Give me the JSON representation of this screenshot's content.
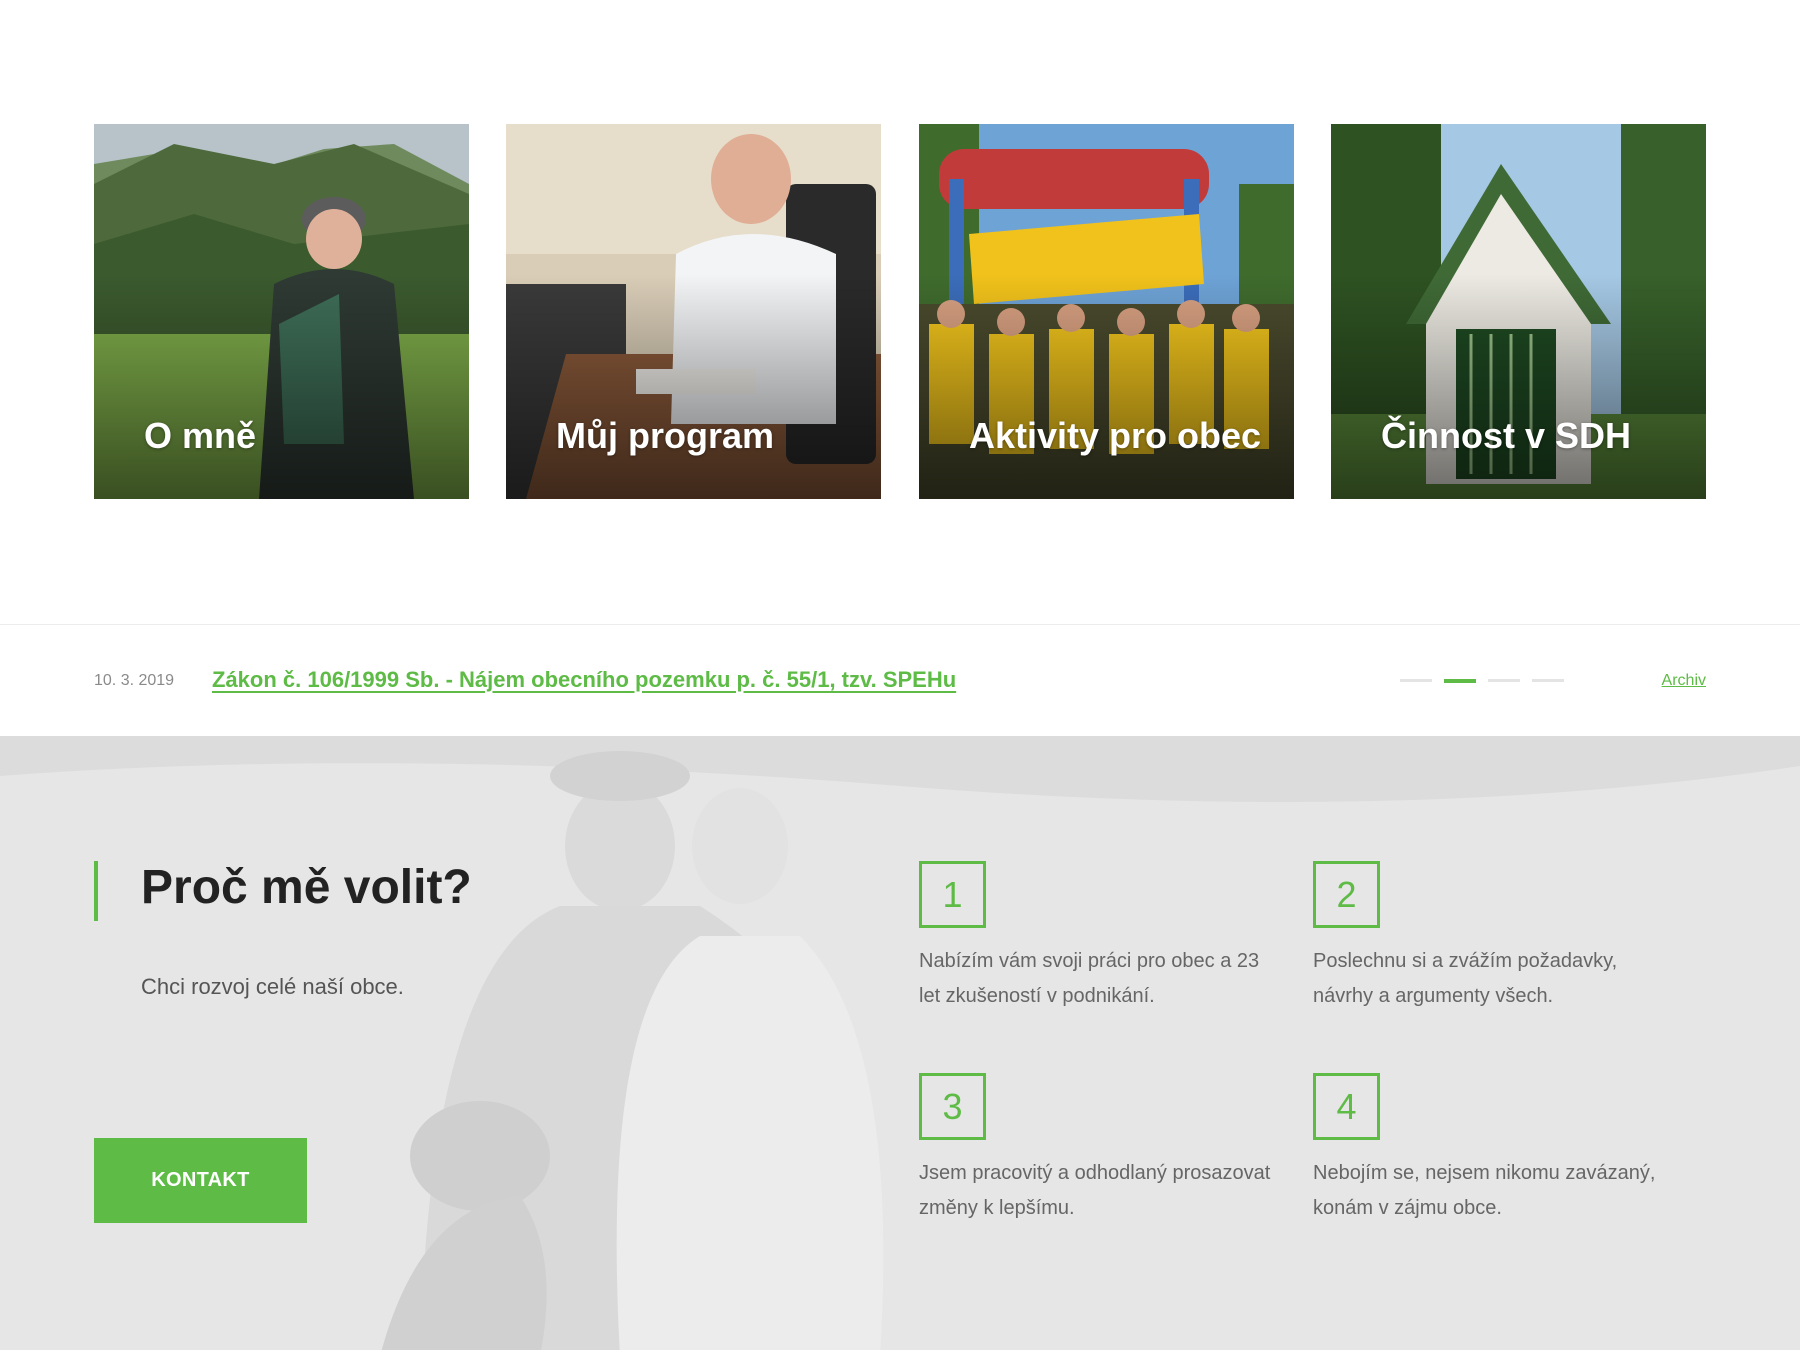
{
  "cards": [
    {
      "label": "O mně",
      "icon": "mountain-photo"
    },
    {
      "label": "Můj program",
      "icon": "office-photo"
    },
    {
      "label": "Aktivity pro obec",
      "icon": "group-photo"
    },
    {
      "label": "Činnost v SDH",
      "icon": "firehouse-photo"
    }
  ],
  "news": {
    "date": "10. 3. 2019",
    "headline": "Zákon č. 106/1999 Sb. - Nájem obecního pozemku p. č. 55/1, tzv. SPEHu",
    "archive_label": "Archiv",
    "slide_count": 4,
    "active_slide": 2
  },
  "why": {
    "title": "Proč mě volit?",
    "subtitle": "Chci rozvoj celé naší obce.",
    "button_label": "KONTAKT",
    "reasons": [
      {
        "number": "1",
        "text": "Nabízím vám svoji práci pro obec a 23 let zkušeností v podnikání."
      },
      {
        "number": "2",
        "text": "Poslechnu si a zvážím požadavky, návrhy a argumenty všech."
      },
      {
        "number": "3",
        "text": "Jsem pracovitý a odhodlaný prosazovat změny k lepšímu."
      },
      {
        "number": "4",
        "text": "Nebojím se, nejsem nikomu zavázaný, konám v zájmu obce."
      }
    ]
  },
  "colors": {
    "accent": "#5dbb46",
    "text_dark": "#222222",
    "section_bg": "#e6e6e6"
  }
}
